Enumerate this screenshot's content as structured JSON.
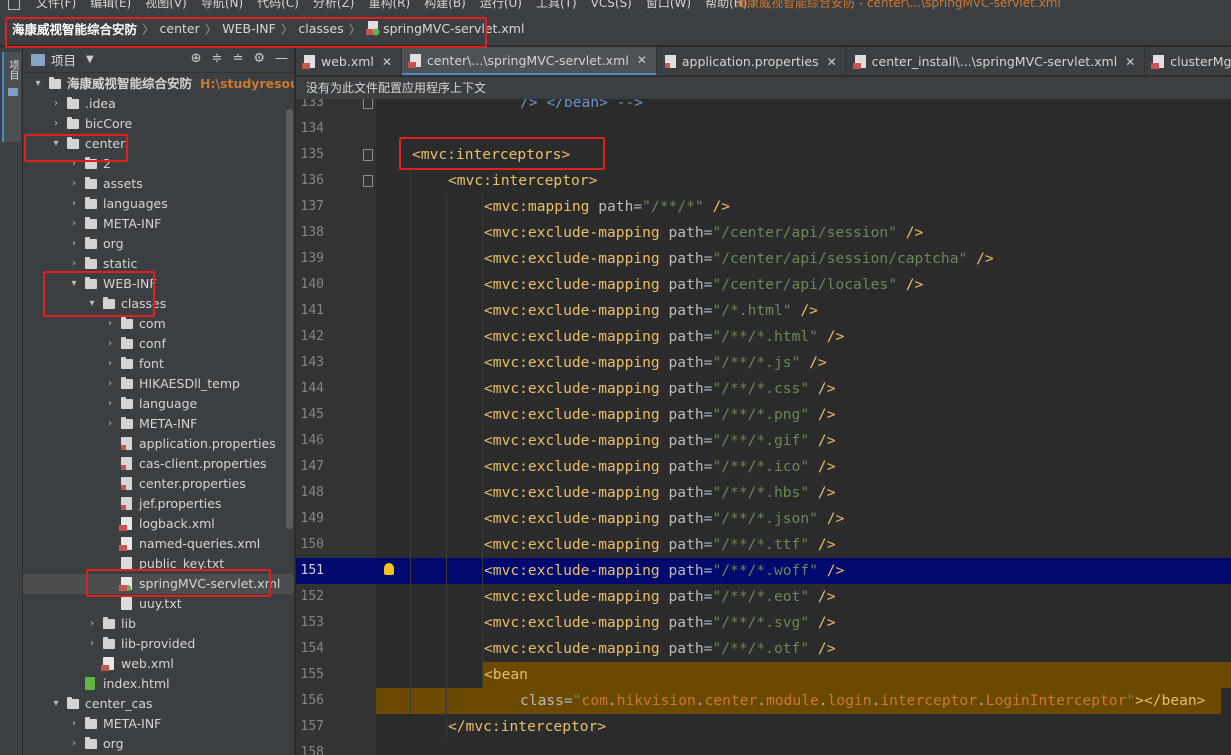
{
  "menubar": {
    "items": [
      "文件(F)",
      "编辑(E)",
      "视图(V)",
      "导航(N)",
      "代码(C)",
      "分析(Z)",
      "重构(R)",
      "构建(B)",
      "运行(U)",
      "工具(T)",
      "VCS(S)",
      "窗口(W)",
      "帮助(H)"
    ],
    "window_title": "海康威视智能综合安防 - center\\...\\springMVC-servlet.xml"
  },
  "breadcrumb": {
    "items": [
      "海康威视智能综合安防",
      "center",
      "WEB-INF",
      "classes",
      "springMVC-servlet.xml"
    ],
    "separator": "〉"
  },
  "toolstrip": {
    "project_tab_label": "项目"
  },
  "project_panel": {
    "title": "项目",
    "root_name": "海康威视智能综合安防",
    "root_path": "H:\\studyresource\\",
    "items": [
      {
        "label": "海康威视智能综合安防",
        "depth": 0,
        "kind": "root",
        "open": true
      },
      {
        "label": ".idea",
        "depth": 1,
        "kind": "folder",
        "open": false
      },
      {
        "label": "bicCore",
        "depth": 1,
        "kind": "folder",
        "open": false
      },
      {
        "label": "center",
        "depth": 1,
        "kind": "folder",
        "open": true
      },
      {
        "label": "2",
        "depth": 2,
        "kind": "folder",
        "open": false
      },
      {
        "label": "assets",
        "depth": 2,
        "kind": "folder",
        "open": false
      },
      {
        "label": "languages",
        "depth": 2,
        "kind": "folder",
        "open": false
      },
      {
        "label": "META-INF",
        "depth": 2,
        "kind": "folder",
        "open": false
      },
      {
        "label": "org",
        "depth": 2,
        "kind": "folder",
        "open": false
      },
      {
        "label": "static",
        "depth": 2,
        "kind": "folder",
        "open": false
      },
      {
        "label": "WEB-INF",
        "depth": 2,
        "kind": "folder",
        "open": true
      },
      {
        "label": "classes",
        "depth": 3,
        "kind": "folder",
        "open": true
      },
      {
        "label": "com",
        "depth": 4,
        "kind": "folder",
        "open": false
      },
      {
        "label": "conf",
        "depth": 4,
        "kind": "folder",
        "open": false
      },
      {
        "label": "font",
        "depth": 4,
        "kind": "folder",
        "open": false
      },
      {
        "label": "HIKAESDll_temp",
        "depth": 4,
        "kind": "folder",
        "open": false
      },
      {
        "label": "language",
        "depth": 4,
        "kind": "folder",
        "open": false
      },
      {
        "label": "META-INF",
        "depth": 4,
        "kind": "folder",
        "open": false
      },
      {
        "label": "application.properties",
        "depth": 4,
        "kind": "props"
      },
      {
        "label": "cas-client.properties",
        "depth": 4,
        "kind": "props"
      },
      {
        "label": "center.properties",
        "depth": 4,
        "kind": "props"
      },
      {
        "label": "jef.properties",
        "depth": 4,
        "kind": "props"
      },
      {
        "label": "logback.xml",
        "depth": 4,
        "kind": "xml"
      },
      {
        "label": "named-queries.xml",
        "depth": 4,
        "kind": "xml"
      },
      {
        "label": "public_key.txt",
        "depth": 4,
        "kind": "txt"
      },
      {
        "label": "springMVC-servlet.xml",
        "depth": 4,
        "kind": "spring",
        "selected": true
      },
      {
        "label": "uuy.txt",
        "depth": 4,
        "kind": "txt"
      },
      {
        "label": "lib",
        "depth": 3,
        "kind": "folder",
        "open": false
      },
      {
        "label": "lib-provided",
        "depth": 3,
        "kind": "folder",
        "open": false
      },
      {
        "label": "web.xml",
        "depth": 3,
        "kind": "xml"
      },
      {
        "label": "index.html",
        "depth": 2,
        "kind": "html"
      },
      {
        "label": "center_cas",
        "depth": 1,
        "kind": "folder",
        "open": true
      },
      {
        "label": "META-INF",
        "depth": 2,
        "kind": "folder",
        "open": false
      },
      {
        "label": "org",
        "depth": 2,
        "kind": "folder",
        "open": false
      }
    ]
  },
  "tabs": [
    {
      "label": "web.xml",
      "icon": "xml-icon",
      "active": false
    },
    {
      "label": "center\\...\\springMVC-servlet.xml",
      "icon": "xml-icon",
      "active": true
    },
    {
      "label": "application.properties",
      "icon": "props-icon",
      "active": false
    },
    {
      "label": "center_install\\...\\springMVC-servlet.xml",
      "icon": "xml-icon",
      "active": false
    },
    {
      "label": "clusterMgr\\...\\spring",
      "icon": "xml-icon",
      "active": false
    }
  ],
  "notice": "没有为此文件配置应用程序上下文",
  "code": {
    "current_line": "151",
    "lines": [
      {
        "n": "133",
        "text": "/> </bean> -->"
      },
      {
        "n": "134",
        "text": ""
      },
      {
        "n": "135",
        "text": "<mvc:interceptors>"
      },
      {
        "n": "136",
        "text": "<mvc:interceptor>"
      },
      {
        "n": "137",
        "text": "<mvc:mapping path=\"/**/*\" />"
      },
      {
        "n": "138",
        "text": "<mvc:exclude-mapping path=\"/center/api/session\" />"
      },
      {
        "n": "139",
        "text": "<mvc:exclude-mapping path=\"/center/api/session/captcha\" />"
      },
      {
        "n": "140",
        "text": "<mvc:exclude-mapping path=\"/center/api/locales\" />"
      },
      {
        "n": "141",
        "text": "<mvc:exclude-mapping path=\"/*.html\" />"
      },
      {
        "n": "142",
        "text": "<mvc:exclude-mapping path=\"/**/*.html\" />"
      },
      {
        "n": "143",
        "text": "<mvc:exclude-mapping path=\"/**/*.js\" />"
      },
      {
        "n": "144",
        "text": "<mvc:exclude-mapping path=\"/**/*.css\" />"
      },
      {
        "n": "145",
        "text": "<mvc:exclude-mapping path=\"/**/*.png\" />"
      },
      {
        "n": "146",
        "text": "<mvc:exclude-mapping path=\"/**/*.gif\" />"
      },
      {
        "n": "147",
        "text": "<mvc:exclude-mapping path=\"/**/*.ico\" />"
      },
      {
        "n": "148",
        "text": "<mvc:exclude-mapping path=\"/**/*.hbs\" />"
      },
      {
        "n": "149",
        "text": "<mvc:exclude-mapping path=\"/**/*.json\" />"
      },
      {
        "n": "150",
        "text": "<mvc:exclude-mapping path=\"/**/*.ttf\" />"
      },
      {
        "n": "151",
        "text": "<mvc:exclude-mapping path=\"/**/*.woff\" />"
      },
      {
        "n": "152",
        "text": "<mvc:exclude-mapping path=\"/**/*.eot\" />"
      },
      {
        "n": "153",
        "text": "<mvc:exclude-mapping path=\"/**/*.svg\" />"
      },
      {
        "n": "154",
        "text": "<mvc:exclude-mapping path=\"/**/*.otf\" />"
      },
      {
        "n": "155",
        "text": "<bean"
      },
      {
        "n": "156",
        "text": "class=\"com.hikvision.center.module.login.interceptor.LoginInterceptor\"></bean>"
      },
      {
        "n": "157",
        "text": "</mvc:interceptor>"
      },
      {
        "n": "158",
        "text": ""
      }
    ]
  },
  "colors": {
    "tag": "#e8bf6a",
    "attribute": "#bababa",
    "value": "#6a8759",
    "current_line_bg": "#000a6e",
    "bean_highlight": "#6b4a00",
    "annotation_box": "#e02020",
    "accent": "#4a88c7"
  }
}
